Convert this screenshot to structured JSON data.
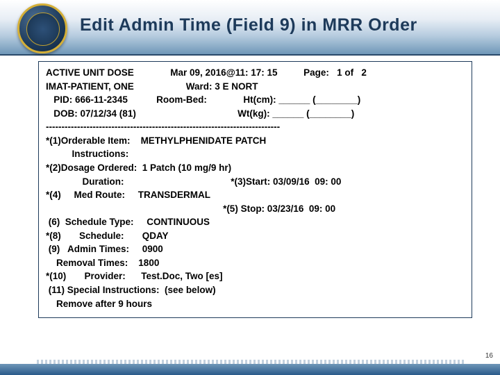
{
  "header": {
    "title": "Edit Admin Time (Field 9) in MRR Order"
  },
  "box": {
    "line1_a": "ACTIVE UNIT DOSE",
    "line1_b": "Mar 09, 2016@11: 17: 15",
    "line1_c": "Page:   1 of   2",
    "line2_a": "IMAT-PATIENT, ONE",
    "line2_b": "Ward: 3 E NORT",
    "line3_a": "PID: 666-11-2345",
    "line3_b": "Room-Bed:",
    "line3_c": "Ht(cm): ______ (________)",
    "line4_a": "DOB: 07/12/34 (81)",
    "line4_b": "Wt(kg): ______ (________)",
    "divider": "---------------------------------------------------------------------------",
    "f1_label": "*(1)Orderable Item:",
    "f1_val": "METHYLPHENIDATE PATCH",
    "instr": "Instructions:",
    "f2": "*(2)Dosage Ordered:  1 Patch (10 mg/9 hr)",
    "dur": "Duration:",
    "f3": "*(3)Start: 03/09/16  09: 00",
    "f4": "*(4)     Med Route:     TRANSDERMAL",
    "f5": "*(5) Stop: 03/23/16  09: 00",
    "f6": " (6)  Schedule Type:     CONTINUOUS",
    "f8": "*(8)       Schedule:       QDAY",
    "f9": " (9)   Admin Times:     0900",
    "rem": "    Removal Times:    1800",
    "f10": "*(10)       Provider:      Test.Doc, Two [es]",
    "f11": " (11) Special Instructions:  (see below)",
    "rem9": "    Remove after 9 hours"
  },
  "pagenum": "16"
}
